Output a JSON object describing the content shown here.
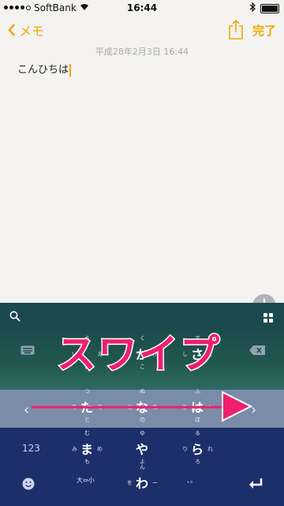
{
  "status": {
    "carrier": "SoftBank",
    "time": "16:44"
  },
  "nav": {
    "back_label": "メモ",
    "done_label": "完了"
  },
  "note": {
    "date": "平成28年2月3日 16:44",
    "text": "こんひちは"
  },
  "keyboard": {
    "row1": [
      {
        "main": "",
        "top": "う",
        "left": "い",
        "right": "え",
        "bottom": "お"
      },
      {
        "main": "か",
        "top": "く",
        "left": "き",
        "right": "け",
        "bottom": "こ"
      },
      {
        "main": "さ",
        "top": "す",
        "left": "し",
        "right": "せ",
        "bottom": "そ"
      }
    ],
    "row2": [
      {
        "main": "た",
        "top": "つ",
        "left": "ち",
        "right": "て",
        "bottom": "と"
      },
      {
        "main": "な",
        "top": "ぬ",
        "left": "に",
        "right": "ね",
        "bottom": "の"
      },
      {
        "main": "は",
        "top": "ふ",
        "left": "ひ",
        "right": "へ",
        "bottom": "ほ"
      }
    ],
    "row3": [
      {
        "main": "ま",
        "top": "む",
        "left": "み",
        "right": "め",
        "bottom": "も"
      },
      {
        "main": "や",
        "top": "ゆ",
        "left": "",
        "right": "",
        "bottom": "よ"
      },
      {
        "main": "ら",
        "top": "る",
        "left": "り",
        "right": "れ",
        "bottom": "ろ"
      }
    ],
    "row4": [
      {
        "main": "",
        "sub": "大⇔小"
      },
      {
        "main": "わ",
        "top": "ん",
        "left": "を",
        "right": "ー",
        "bottom": ""
      },
      {
        "main": "",
        "sub": "、。"
      }
    ],
    "num_label": "123",
    "overlay_text": "スワイプ"
  },
  "colors": {
    "accent": "#f0a800",
    "overlay": "#ef1f6e"
  }
}
